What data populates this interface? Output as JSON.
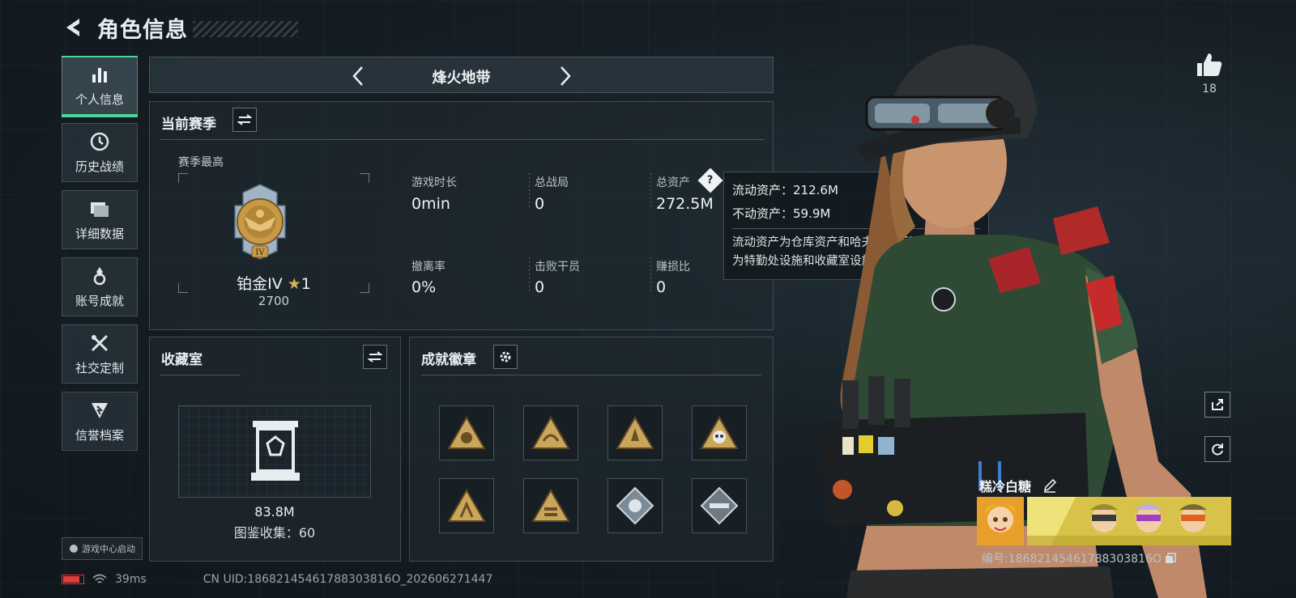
{
  "header": {
    "title": "角色信息"
  },
  "sidebar": {
    "items": [
      {
        "label": "个人信息",
        "icon": "bar-chart-icon",
        "active": true
      },
      {
        "label": "历史战绩",
        "icon": "clock-icon",
        "active": false
      },
      {
        "label": "详细数据",
        "icon": "folder-icon",
        "active": false
      },
      {
        "label": "账号成就",
        "icon": "medal-icon",
        "active": false
      },
      {
        "label": "社交定制",
        "icon": "tools-icon",
        "active": false
      },
      {
        "label": "信誉档案",
        "icon": "shield-icon",
        "active": false
      }
    ],
    "launcher_label": "游戏中心启动"
  },
  "mode": {
    "name": "烽火地带"
  },
  "season": {
    "title": "当前赛季",
    "highest_label": "赛季最高",
    "rank_name": "铂金IV",
    "stars": "1",
    "points": "2700",
    "stats": [
      {
        "label": "游戏时长",
        "value": "0min"
      },
      {
        "label": "总战局",
        "value": "0"
      },
      {
        "label": "总资产",
        "value": "272.5M"
      },
      {
        "label": "撤离率",
        "value": "0%"
      },
      {
        "label": "击败干员",
        "value": "0"
      },
      {
        "label": "赚损比",
        "value": "0"
      }
    ]
  },
  "tooltip": {
    "liquid": "流动资产：212.6M",
    "fixed": "不动资产：59.9M",
    "desc_line1": "流动资产为仓库资产和哈夫币，不动资产",
    "desc_line2": "为特勤处设施和收藏室设施"
  },
  "collection": {
    "title": "收藏室",
    "value": "83.8M",
    "catalog": "图鉴收集：60"
  },
  "badges": {
    "title": "成就徽章",
    "items": [
      "badge-1",
      "badge-2",
      "badge-3",
      "badge-4",
      "badge-5",
      "badge-6",
      "badge-7",
      "badge-8"
    ]
  },
  "profile": {
    "likes": "18",
    "name": "糕冷白糖",
    "uid_label": "编号:18682145461788303816O"
  },
  "status": {
    "ping": "39ms",
    "uid": "CN UID:18682145461788303816O_202606271447"
  },
  "colors": {
    "accent": "#4fd49a",
    "gold": "#d4a24a",
    "battery": "#e23b3b"
  }
}
